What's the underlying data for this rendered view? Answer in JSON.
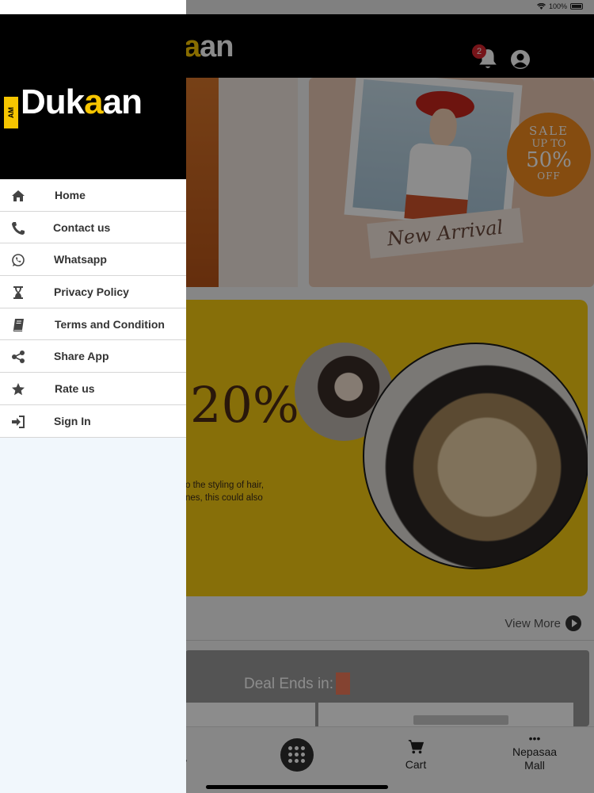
{
  "status": {
    "battery": "100%"
  },
  "appbar": {
    "logo_main": "D",
    "logo_accent": "a",
    "logo_rest": "an",
    "notification_count": "2"
  },
  "promo1": {
    "sale_l1": "SALE",
    "sale_l2": "UP TO",
    "sale_l3": "50%",
    "sale_l4": "OFF",
    "ribbon": "New Arrival"
  },
  "promo2": {
    "percent": "20%",
    "desc_line1": "o the styling of hair,",
    "desc_line2": "nes, this could also"
  },
  "section": {
    "view_more": "View More"
  },
  "deal": {
    "label": "Deal Ends in:"
  },
  "bottom_nav": {
    "left_label": "ity",
    "cart": "Cart",
    "mall": "Nepasaa Mall",
    "more_dots": "•••"
  },
  "drawer": {
    "logo_prefix": "AM",
    "logo_main": "Duk",
    "logo_accent": "a",
    "logo_rest": "an",
    "items": [
      {
        "label": "Home",
        "icon": "home-icon"
      },
      {
        "label": "Contact us",
        "icon": "phone-icon"
      },
      {
        "label": "Whatsapp",
        "icon": "whatsapp-icon"
      },
      {
        "label": "Privacy Policy",
        "icon": "hourglass-icon"
      },
      {
        "label": "Terms and Condition",
        "icon": "book-icon"
      },
      {
        "label": "Share App",
        "icon": "share-icon"
      },
      {
        "label": "Rate us",
        "icon": "star-icon"
      },
      {
        "label": "Sign In",
        "icon": "sign-in-icon"
      }
    ]
  },
  "colors": {
    "accent": "#f6c500",
    "header": "#000000",
    "drawer_bg": "#f1f7fc",
    "badge": "#d8262f"
  }
}
